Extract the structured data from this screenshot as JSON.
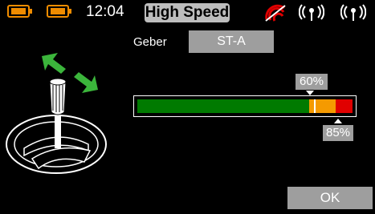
{
  "status": {
    "time": "12:04",
    "mode": "High Speed",
    "accent_color": "#f08c00"
  },
  "geber": {
    "label": "Geber",
    "value": "ST-A"
  },
  "bar": {
    "segments": [
      {
        "color": "#007a00",
        "from_pct": 0,
        "to_pct": 80
      },
      {
        "color": "#f59a00",
        "from_pct": 80,
        "to_pct": 92
      },
      {
        "color": "#e00000",
        "from_pct": 92,
        "to_pct": 100
      }
    ],
    "position_pct": 82,
    "upper_threshold": "60%",
    "lower_threshold": "85%"
  },
  "ok_label": "OK",
  "icons": [
    "battery-icon",
    "battery-icon",
    "signal-off-icon",
    "antenna-icon",
    "antenna-icon",
    "stick-icon",
    "arrow-icon"
  ]
}
